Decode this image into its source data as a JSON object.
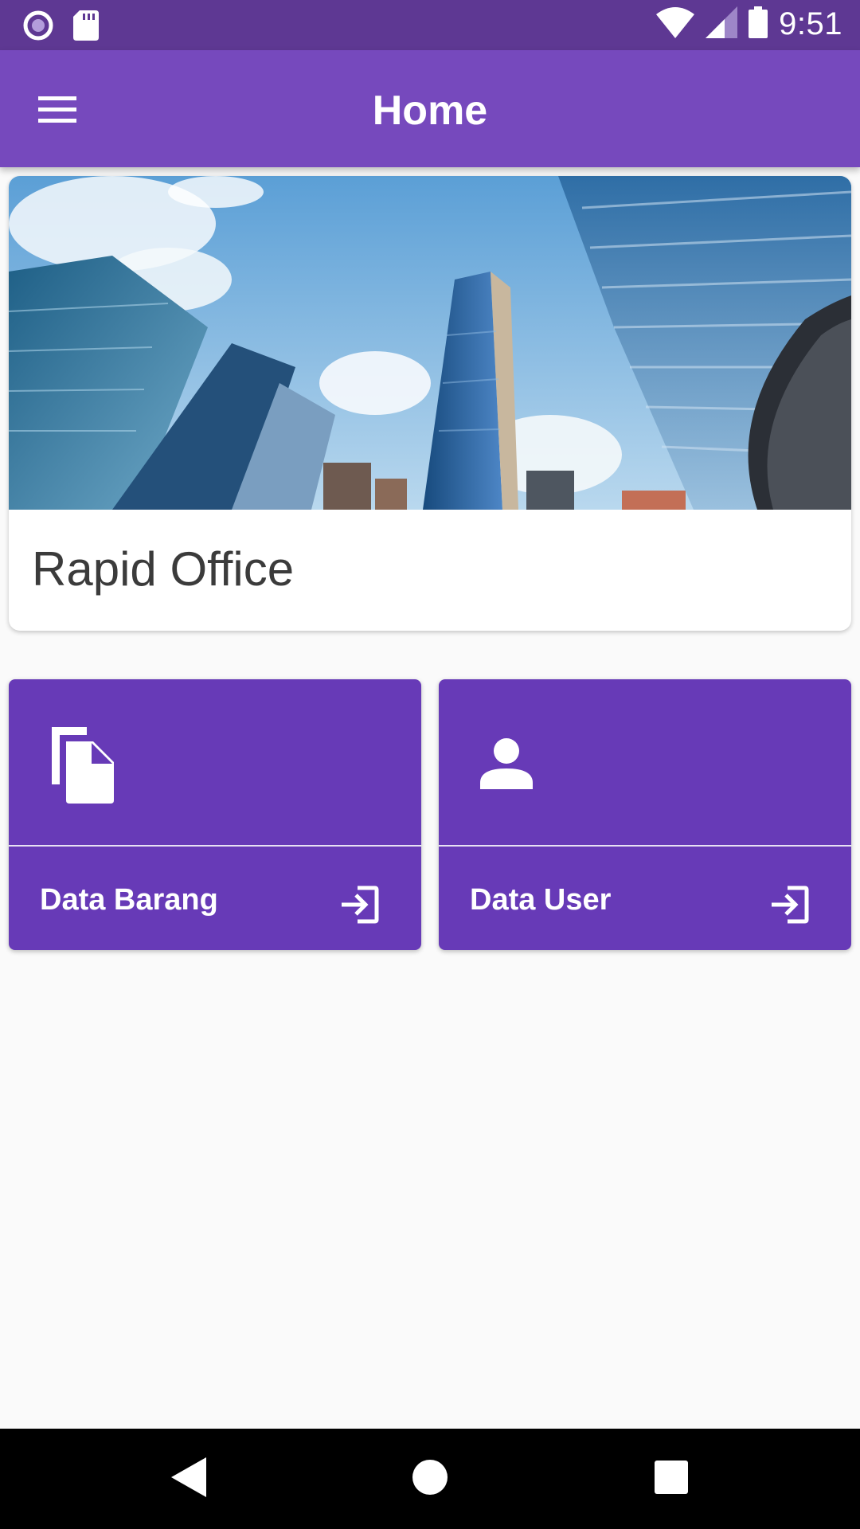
{
  "status_bar": {
    "time": "9:51",
    "left_icons": [
      "notification-circle-icon",
      "sd-card-icon"
    ],
    "right_icons": [
      "wifi-icon",
      "cell-signal-icon",
      "battery-icon"
    ]
  },
  "app_bar": {
    "title": "Home",
    "menu_icon": "hamburger-menu-icon",
    "color": "#7649bd"
  },
  "hero": {
    "image": "city-skyscrapers-photo",
    "title": "Rapid Office"
  },
  "menu_cards": [
    {
      "label": "Data Barang",
      "icon": "file-copy-icon",
      "action_icon": "login-enter-icon"
    },
    {
      "label": "Data User",
      "icon": "person-icon",
      "action_icon": "login-enter-icon"
    }
  ],
  "nav_bar": {
    "buttons": [
      "back-icon",
      "home-icon",
      "recents-icon"
    ]
  },
  "colors": {
    "status_bar": "#5e3893",
    "app_bar": "#7649bd",
    "card": "#673ab7",
    "background": "#fafafa"
  }
}
